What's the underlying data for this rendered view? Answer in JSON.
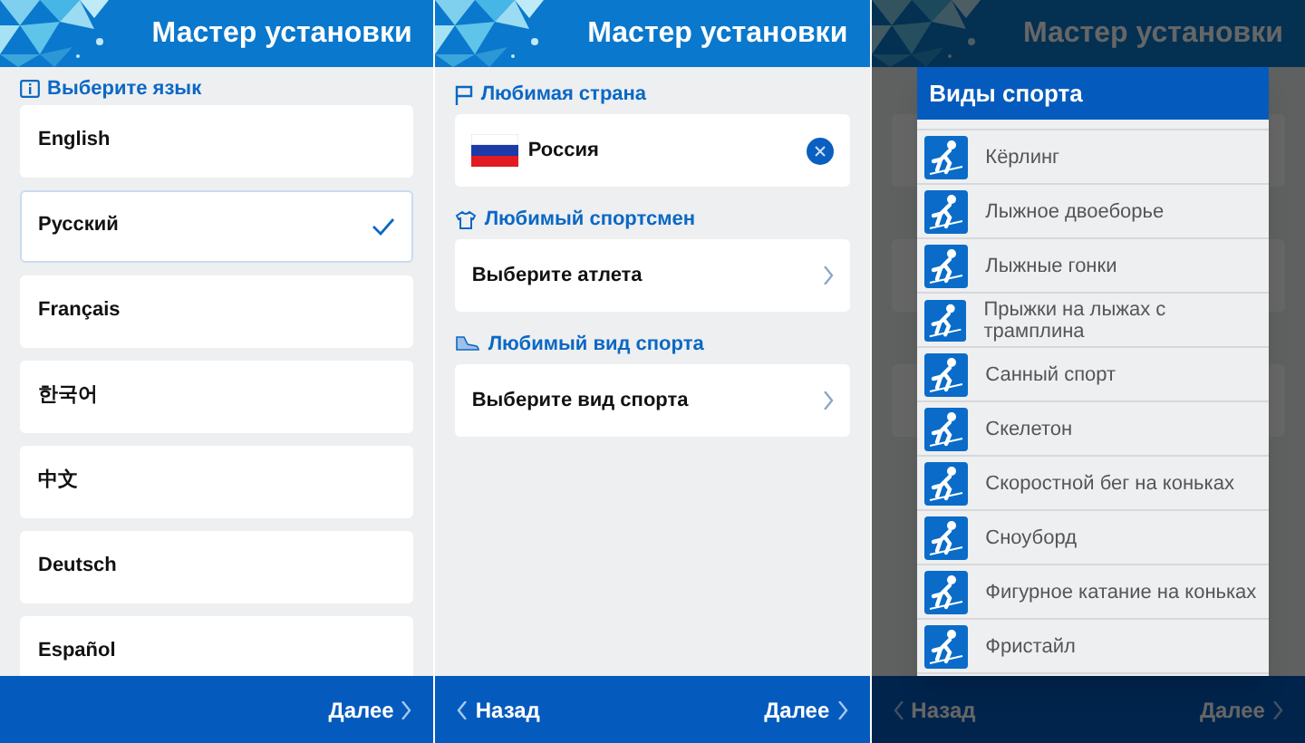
{
  "screens": [
    {
      "kind": "language",
      "title": "Мастер установки",
      "heading": "Выберите язык",
      "languages": [
        {
          "label": "English",
          "selected": false
        },
        {
          "label": "Русский",
          "selected": true
        },
        {
          "label": "Français",
          "selected": false
        },
        {
          "label": "한국어",
          "selected": false
        },
        {
          "label": "中文",
          "selected": false
        },
        {
          "label": "Deutsch",
          "selected": false
        },
        {
          "label": "Español",
          "selected": false
        }
      ],
      "next": "Далее"
    },
    {
      "kind": "favorites",
      "title": "Мастер установки",
      "sections": [
        {
          "kind": "country",
          "heading": "Любимая страна",
          "value": "Россия"
        },
        {
          "kind": "picker",
          "heading": "Любимый спортсмен",
          "value": "Выберите атлета"
        },
        {
          "kind": "picker",
          "heading": "Любимый вид спорта",
          "value": "Выберите вид спорта"
        }
      ],
      "back": "Назад",
      "next": "Далее"
    },
    {
      "kind": "dialog",
      "title": "Мастер установки",
      "back": "Назад",
      "next": "Далее",
      "dialog": {
        "title": "Виды спорта",
        "items": [
          "Кёрлинг",
          "Лыжное двоеборье",
          "Лыжные гонки",
          "Прыжки на лыжах с трамплина",
          "Санный спорт",
          "Скелетон",
          "Скоростной бег на коньках",
          "Сноуборд",
          "Фигурное катание на коньках",
          "Фристайл"
        ]
      }
    }
  ]
}
